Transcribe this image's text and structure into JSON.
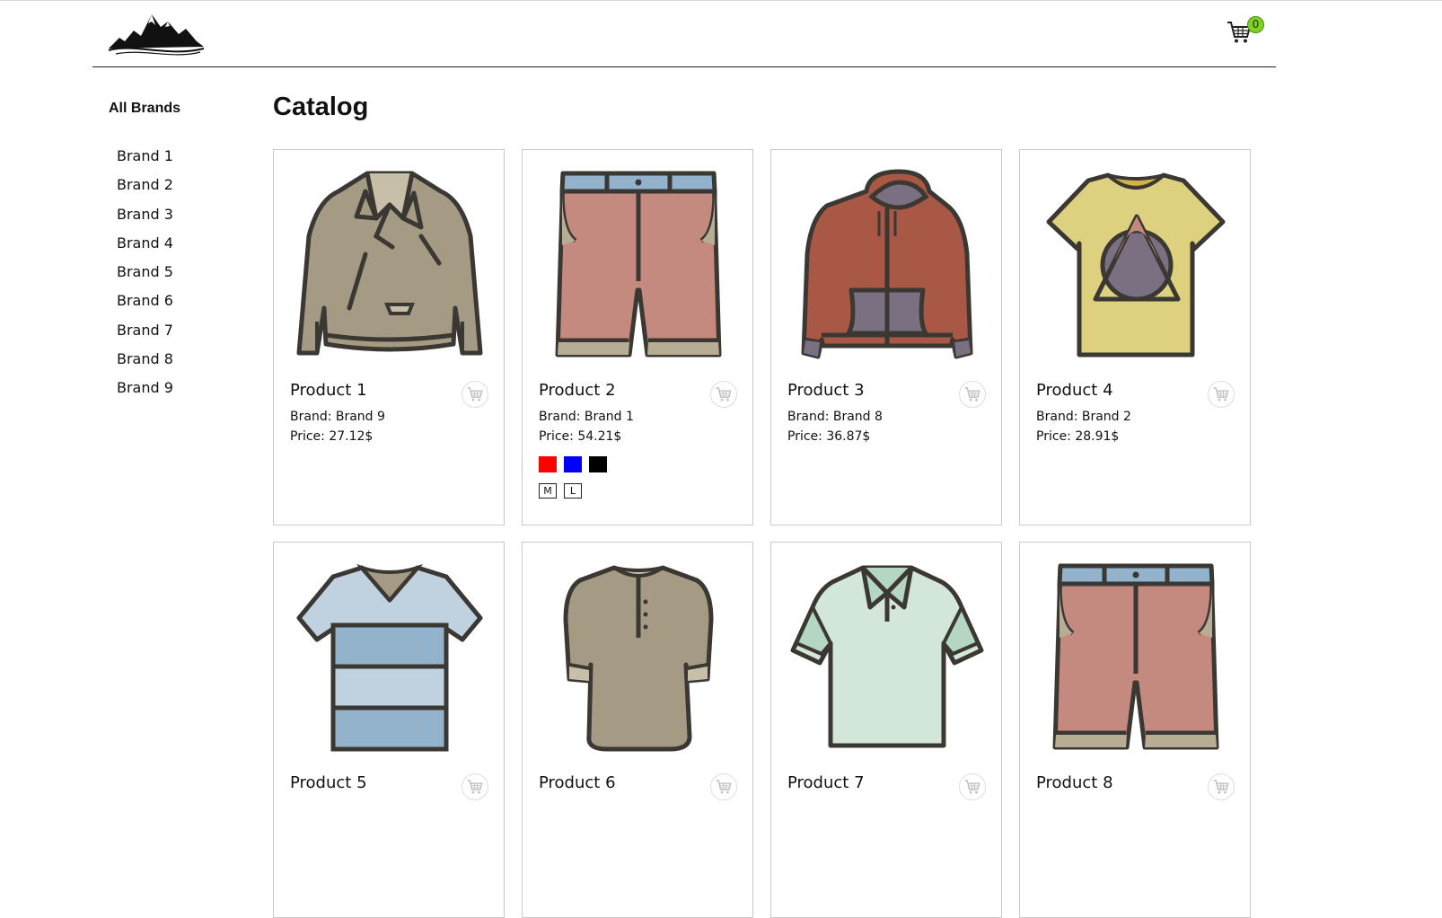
{
  "header": {
    "logo_icon": "mountain-logo-icon",
    "cart_icon": "shopping-cart-icon",
    "cart_count": "0"
  },
  "sidebar": {
    "all_brands": "All Brands",
    "brands": [
      "Brand 1",
      "Brand 2",
      "Brand 3",
      "Brand 4",
      "Brand 5",
      "Brand 6",
      "Brand 7",
      "Brand 8",
      "Brand 9"
    ]
  },
  "main": {
    "title": "Catalog",
    "products": [
      {
        "name": "Product 1",
        "brand": "Brand: Brand 9",
        "price": "Price: 27.12$",
        "image": "leather-jacket-icon"
      },
      {
        "name": "Product 2",
        "brand": "Brand: Brand 1",
        "price": "Price: 54.21$",
        "image": "shorts-icon",
        "colors": [
          "#ff0000",
          "#0000ff",
          "#000000"
        ],
        "sizes": [
          "M",
          "L"
        ]
      },
      {
        "name": "Product 3",
        "brand": "Brand: Brand 8",
        "price": "Price: 36.87$",
        "image": "hoodie-icon"
      },
      {
        "name": "Product 4",
        "brand": "Brand: Brand 2",
        "price": "Price: 28.91$",
        "image": "tshirt-triangle-icon"
      },
      {
        "name": "Product 5",
        "image": "striped-vneck-tshirt-icon"
      },
      {
        "name": "Product 6",
        "image": "henley-shirt-icon"
      },
      {
        "name": "Product 7",
        "image": "polo-shirt-icon"
      },
      {
        "name": "Product 8",
        "image": "shorts-icon"
      }
    ]
  }
}
